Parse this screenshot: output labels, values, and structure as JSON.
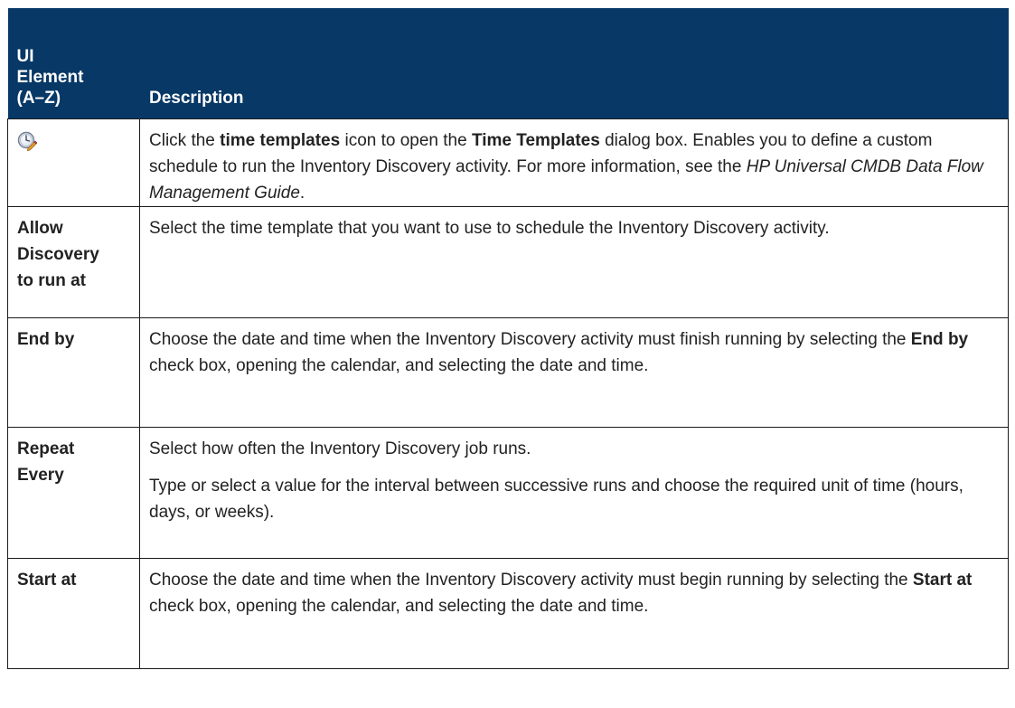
{
  "header": {
    "col1": [
      "UI",
      "Element",
      "(A–Z)"
    ],
    "col2": "Description"
  },
  "rows": [
    {
      "icon": "time-templates-icon",
      "desc": {
        "t1": "Click the ",
        "b1": "time templates",
        "t2": " icon to open the ",
        "b2": "Time Templates",
        "t3": " dialog box. Enables you to define a custom schedule to run the Inventory Discovery activity. For more information, see the ",
        "i1": "HP Universal CMDB Data Flow Management Guide",
        "t4": "."
      }
    },
    {
      "name": [
        "Allow",
        "Discovery",
        "to run at"
      ],
      "desc": {
        "t1": "Select the time template that you want to use to schedule the Inventory Discovery activity."
      }
    },
    {
      "name": [
        "End by"
      ],
      "desc": {
        "t1": "Choose the date and time when the Inventory Discovery activity must finish running by selecting the ",
        "b1": "End by",
        "t2": " check box, opening the calendar, and selecting the date and time."
      }
    },
    {
      "name": [
        "Repeat",
        "Every"
      ],
      "desc": {
        "p1": "Select how often the Inventory Discovery job runs.",
        "p2": "Type or select a value for the interval between successive runs and choose the required unit of time (hours, days, or weeks)."
      }
    },
    {
      "name": [
        "Start at"
      ],
      "desc": {
        "t1": "Choose the date and time when the Inventory Discovery activity must begin running by selecting the ",
        "b1": "Start at",
        "t2": " check box, opening the calendar, and selecting the date and time."
      }
    }
  ],
  "colors": {
    "header_bg": "#073866",
    "header_text": "#ffffff",
    "border": "#1a1a1a"
  }
}
